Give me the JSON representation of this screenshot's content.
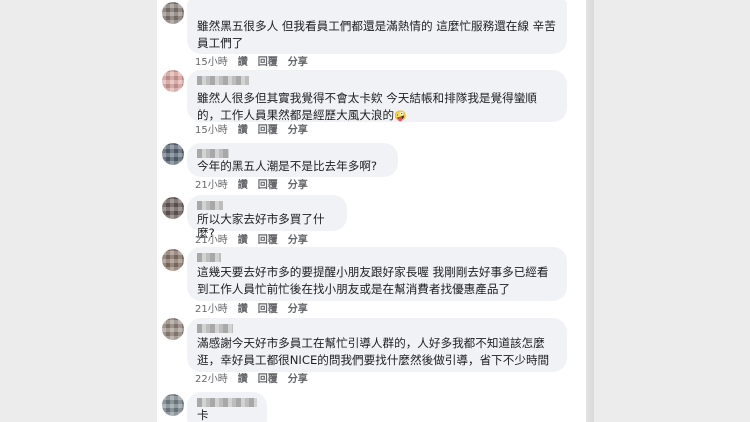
{
  "comments": [
    {
      "text": "雖然黑五很多人 但我看員工們都還是滿熱情的 這麼忙服務還在線 辛苦員工們了",
      "time": "15小時",
      "actions": [
        "讚",
        "回覆",
        "分享"
      ],
      "avatar_color": "#8a7f78"
    },
    {
      "text": "雖然人很多但其實我覺得不會太卡欸 今天結帳和排隊我是覺得蠻順的，工作人員果然都是經歷大風大浪的",
      "emoji": "🤪",
      "time": "15小時",
      "actions": [
        "讚",
        "回覆",
        "分享"
      ],
      "avatar_color": "#e0a9a3"
    },
    {
      "text": "今年的黑五人潮是不是比去年多啊?",
      "time": "21小時",
      "actions": [
        "讚",
        "回覆",
        "分享"
      ],
      "avatar_color": "#5a6a78"
    },
    {
      "text": "所以大家去好市多買了什麼?",
      "time": "21小時",
      "actions": [
        "讚",
        "回覆",
        "分享"
      ],
      "avatar_color": "#6b5e5b"
    },
    {
      "text": "這幾天要去好市多的要提醒小朋友跟好家長喔 我剛剛去好事多已經看到工作人員忙前忙後在找小朋友或是在幫消費者找優惠產品了",
      "time": "21小時",
      "actions": [
        "讚",
        "回覆",
        "分享"
      ],
      "avatar_color": "#8f7b6d"
    },
    {
      "text": "滿感謝今天好市多員工在幫忙引導人群的，人好多我都不知道該怎麼逛，幸好員工都很NICE的問我們要找什麼然後做引導，省下不少時間",
      "time": "22小時",
      "actions": [
        "讚",
        "回覆",
        "分享"
      ],
      "avatar_color": "#9a8d84"
    },
    {
      "text": "卡",
      "time": "",
      "actions": [],
      "avatar_color": "#7e8a92"
    }
  ]
}
